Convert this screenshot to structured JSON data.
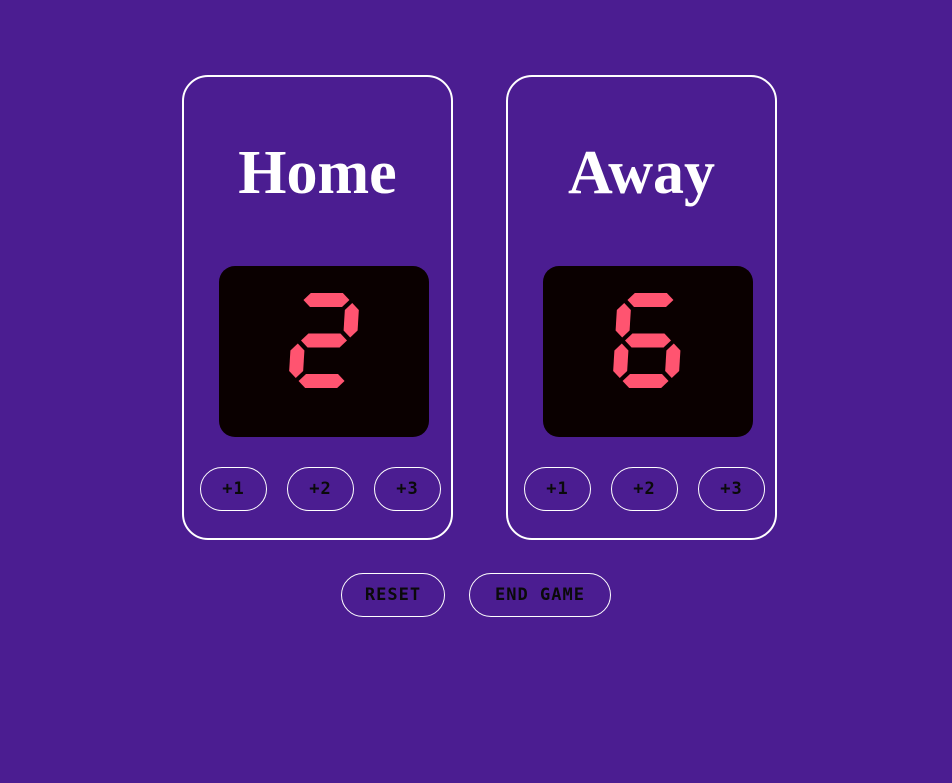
{
  "colors": {
    "background": "#4b1d91",
    "panel_border": "#ffffff",
    "score_box": "#0a0000",
    "score_digits": "#ff5470",
    "button_text": "#0a0a0a"
  },
  "teams": [
    {
      "name": "Home",
      "score": "2",
      "buttons": [
        "+1",
        "+2",
        "+3"
      ]
    },
    {
      "name": "Away",
      "score": "6",
      "buttons": [
        "+1",
        "+2",
        "+3"
      ]
    }
  ],
  "controls": {
    "reset_label": "RESET",
    "end_game_label": "END GAME"
  }
}
